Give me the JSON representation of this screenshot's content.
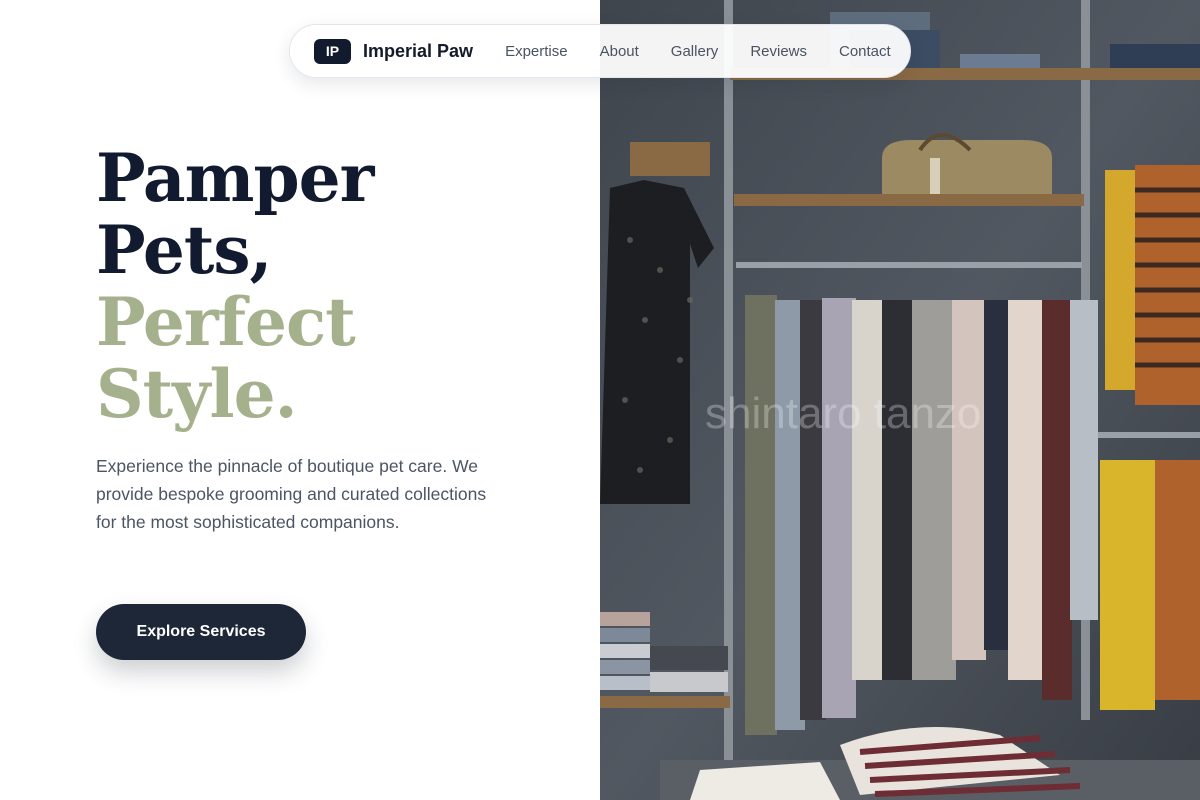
{
  "nav": {
    "logo_badge": "IP",
    "brand": "Imperial Paw",
    "links": [
      "Expertise",
      "About",
      "Gallery",
      "Reviews",
      "Contact"
    ]
  },
  "hero": {
    "headline_dark_1": "Pamper",
    "headline_dark_2": "Pets,",
    "headline_accent_1": "Perfect",
    "headline_accent_2": "Style.",
    "description": "Experience the pinnacle of boutique pet care. We provide bespoke grooming and curated collections for the most sophisticated companions.",
    "cta_label": "Explore Services"
  },
  "image": {
    "subject": "boutique clothing rack photo",
    "watermark": "shintaro tanzo"
  },
  "colors": {
    "primary_dark": "#111a2e",
    "accent_sage": "#a5b08c",
    "button": "#1e2738",
    "body_text": "#4b5563"
  }
}
